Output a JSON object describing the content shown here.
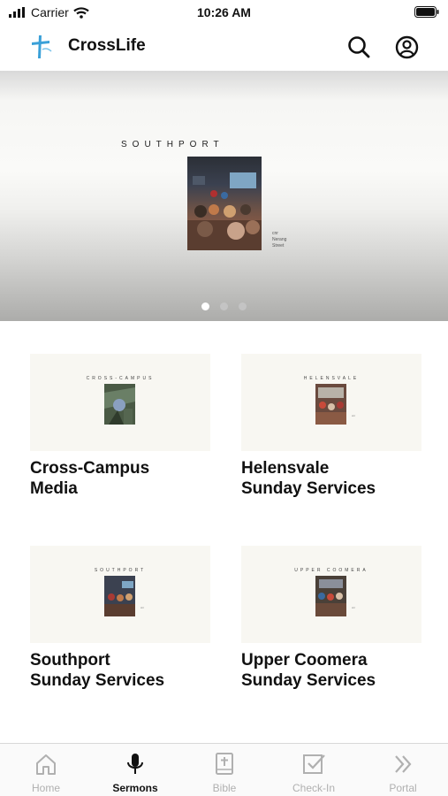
{
  "status_bar": {
    "carrier": "Carrier",
    "time": "10:26 AM"
  },
  "header": {
    "title": "CrossLife",
    "search_icon": "search-icon",
    "account_icon": "account-icon"
  },
  "hero": {
    "campus_label": "SOUTHPORT",
    "caption_lines": [
      "cnr",
      "Nerang",
      "Street"
    ],
    "slides": 3,
    "active_slide": 1
  },
  "cards": [
    {
      "thumb_label": "CROSS-CAMPUS",
      "title_line1": "Cross-Campus",
      "title_line2": "Media"
    },
    {
      "thumb_label": "HELENSVALE",
      "title_line1": "Helensvale",
      "title_line2": "Sunday Services"
    },
    {
      "thumb_label": "SOUTHPORT",
      "title_line1": "Southport",
      "title_line2": "Sunday Services"
    },
    {
      "thumb_label": "UPPER COOMERA",
      "title_line1": "Upper Coomera",
      "title_line2": "Sunday Services"
    }
  ],
  "tabs": [
    {
      "label": "Home",
      "icon": "home-icon",
      "active": false
    },
    {
      "label": "Sermons",
      "icon": "microphone-icon",
      "active": true
    },
    {
      "label": "Bible",
      "icon": "bible-icon",
      "active": false
    },
    {
      "label": "Check-In",
      "icon": "check-in-icon",
      "active": false
    },
    {
      "label": "Portal",
      "icon": "chevrons-right-icon",
      "active": false
    }
  ],
  "colors": {
    "accent": "#111111",
    "inactive_tab": "#b0b0b0",
    "logo_blue": "#3aa0d8"
  }
}
